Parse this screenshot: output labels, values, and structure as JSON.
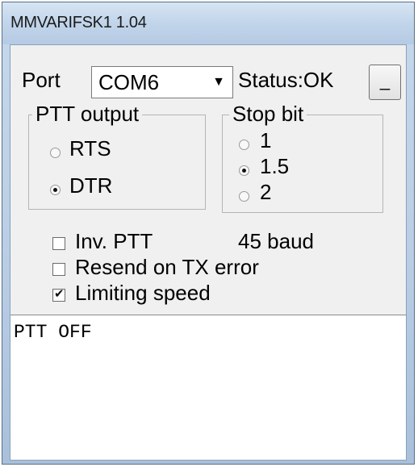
{
  "window": {
    "title": "MMVARIFSK1 1.04"
  },
  "port": {
    "label": "Port",
    "selected": "COM6",
    "status": "Status:OK",
    "minimize_label": "_"
  },
  "ptt_output": {
    "title": "PTT output",
    "options": [
      {
        "label": "RTS",
        "selected": false
      },
      {
        "label": "DTR",
        "selected": true
      }
    ]
  },
  "stop_bit": {
    "title": "Stop bit",
    "options": [
      {
        "label": "1",
        "selected": false
      },
      {
        "label": "1.5",
        "selected": true
      },
      {
        "label": "2",
        "selected": false
      }
    ]
  },
  "options": {
    "inv_ptt": {
      "label": "Inv. PTT",
      "checked": false
    },
    "resend": {
      "label": "Resend on TX error",
      "checked": false
    },
    "limiting": {
      "label": "Limiting speed",
      "checked": true
    },
    "baud": "45 baud"
  },
  "log": {
    "lines": [
      "PTT OFF"
    ]
  }
}
